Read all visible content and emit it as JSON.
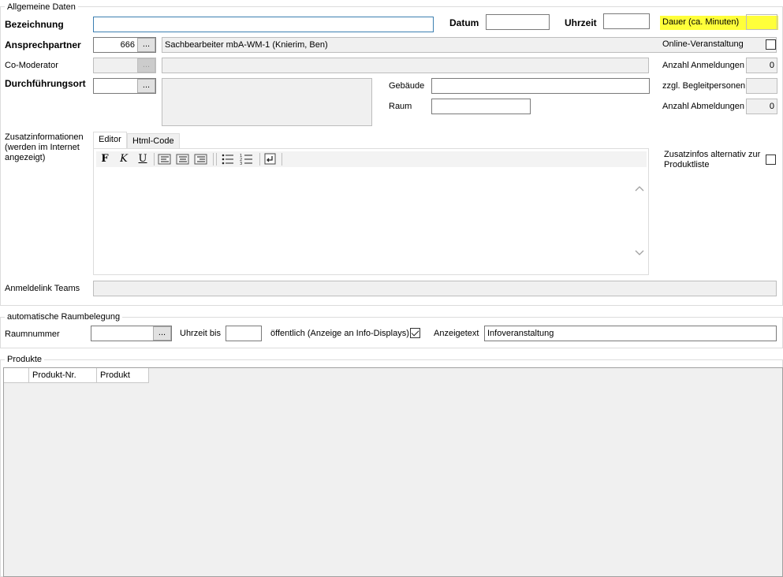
{
  "general": {
    "group_title": "Allgemeine Daten",
    "bezeichnung": {
      "label": "Bezeichnung",
      "value": ""
    },
    "datum": {
      "label": "Datum",
      "value": ""
    },
    "uhrzeit": {
      "label": "Uhrzeit",
      "value": ""
    },
    "dauer": {
      "label": "Dauer (ca. Minuten)",
      "value": ""
    },
    "ansprechpartner": {
      "label": "Ansprechpartner",
      "code": "666",
      "name": "Sachbearbeiter mbA-WM-1 (Knierim, Ben)"
    },
    "co_moderator": {
      "label": "Co-Moderator",
      "code": "",
      "name": ""
    },
    "durchfuehrungsort": {
      "label": "Durchführungsort",
      "code": "",
      "address": ""
    },
    "gebaeude": {
      "label": "Gebäude",
      "value": ""
    },
    "raum": {
      "label": "Raum",
      "value": ""
    },
    "online": {
      "label": "Online-Veranstaltung",
      "checked": false
    },
    "anmeldungen": {
      "label": "Anzahl Anmeldungen",
      "value": "0"
    },
    "begleitpersonen": {
      "label": "zzgl. Begleitpersonen",
      "value": ""
    },
    "abmeldungen": {
      "label": "Anzahl Abmeldungen",
      "value": "0"
    },
    "zusatz": {
      "label": "Zusatzinformationen (werden im Internet angezeigt)",
      "tabs": [
        "Editor",
        "Html-Code"
      ],
      "active_tab": "Editor",
      "toolbar": {
        "bold": "F",
        "italic": "K",
        "underline": "U"
      },
      "content": ""
    },
    "zusatz_alt": {
      "label": "Zusatzinfos alternativ zur Produktliste",
      "checked": false
    },
    "anmeldelink": {
      "label": "Anmeldelink Teams",
      "value": ""
    },
    "ellipsis": "..."
  },
  "raumbelegung": {
    "group_title": "automatische Raumbelegung",
    "raumnummer": {
      "label": "Raumnummer",
      "value": ""
    },
    "uhrzeit_bis": {
      "label": "Uhrzeit bis",
      "value": ""
    },
    "oeffentlich": {
      "label": "öffentlich (Anzeige an Info-Displays)",
      "checked": true
    },
    "anzeigetext": {
      "label": "Anzeigetext",
      "value": "Infoveranstaltung"
    }
  },
  "produkte": {
    "group_title": "Produkte",
    "columns": [
      "Produkt-Nr.",
      "Produkt"
    ],
    "rows": []
  },
  "colors": {
    "highlight": "#ffff3a",
    "window_bg": "#ffffff",
    "readonly_bg": "#f0f0f0"
  }
}
